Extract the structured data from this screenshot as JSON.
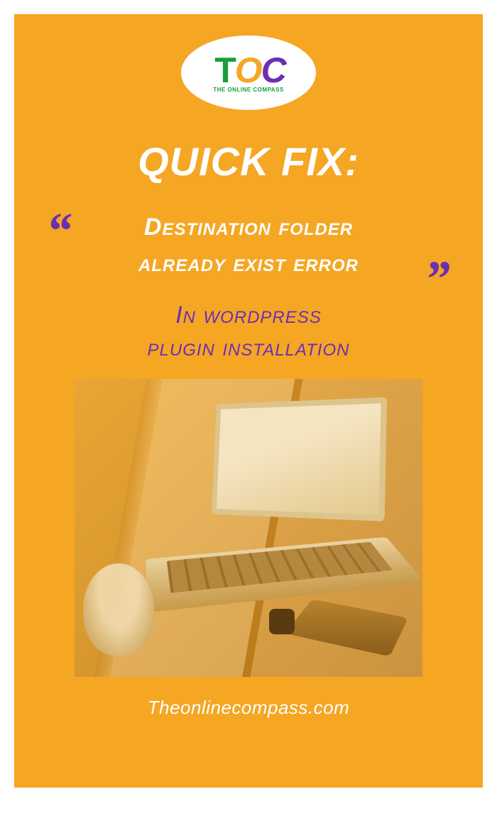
{
  "logo": {
    "letters": {
      "t": "T",
      "o": "O",
      "c": "C"
    },
    "tagline": "THE ONLINE COMPASS"
  },
  "title": "QUICK FIX:",
  "quote": {
    "open": "“",
    "line1": "Destination folder",
    "line2": "already exist error",
    "close": "”"
  },
  "subtitle": {
    "line1": "In wordpress",
    "line2": "plugin installation"
  },
  "footer_url": "Theonlinecompass.com"
}
